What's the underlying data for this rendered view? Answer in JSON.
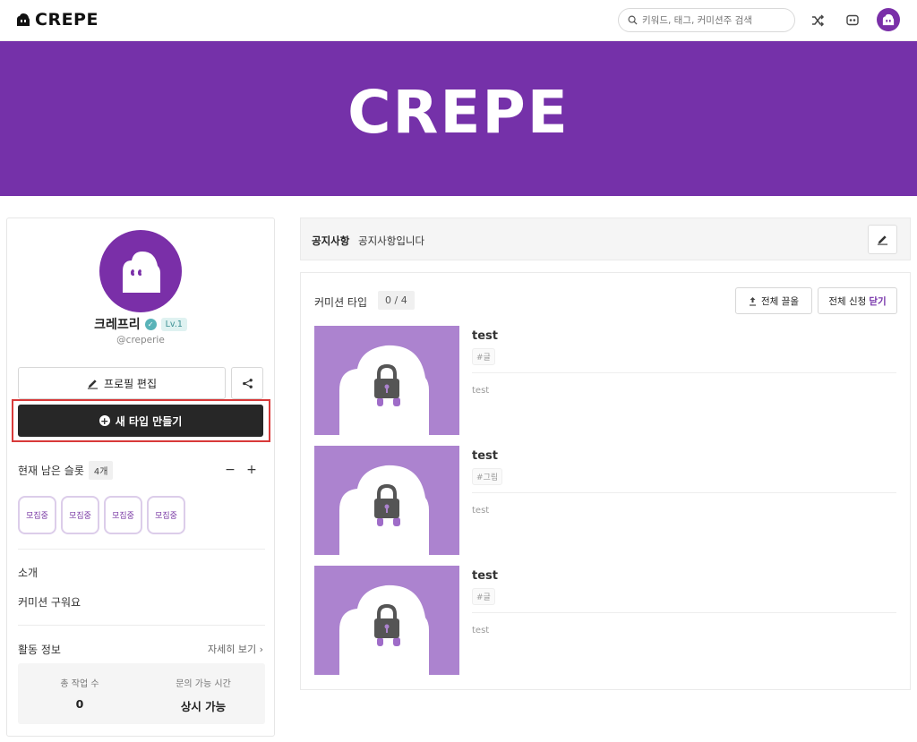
{
  "header": {
    "logo_text": "CREPE",
    "search_placeholder": "키워드, 태그, 커미션주 검색"
  },
  "banner": {
    "text": "CREPE"
  },
  "profile": {
    "name": "크레프리",
    "level": "Lv.1",
    "handle": "@creperie",
    "edit_label": "프로필 편집",
    "new_type_label": "새 타입 만들기"
  },
  "slots": {
    "label": "현재 남은 슬롯",
    "count": "4개",
    "minus": "−",
    "plus": "+",
    "chips": [
      "모집중",
      "모집중",
      "모집중",
      "모집중"
    ]
  },
  "intro": {
    "title": "소개",
    "text": "커미션 구워요"
  },
  "activity": {
    "title": "활동 정보",
    "more_label": "자세히 보기 ›",
    "stats": [
      {
        "label": "총 작업 수",
        "value": "0"
      },
      {
        "label": "문의 가능 시간",
        "value": "상시 가능"
      }
    ]
  },
  "notice": {
    "label": "공지사항",
    "text": "공지사항입니다"
  },
  "types": {
    "title": "커미션 타입",
    "count": "0 / 4",
    "pull_label": "전체 끌올",
    "apply_label": "전체 신청",
    "apply_accent": "닫기",
    "items": [
      {
        "title": "test",
        "tag": "#글",
        "desc": "test"
      },
      {
        "title": "test",
        "tag": "#그림",
        "desc": "test"
      },
      {
        "title": "test",
        "tag": "#글",
        "desc": "test"
      }
    ]
  },
  "colors": {
    "brand": "#7531a9",
    "thumb": "#ac83cf",
    "highlight": "#d83a3a"
  },
  "icons": [
    "search-icon",
    "shuffle-icon",
    "chat-icon",
    "avatar",
    "pencil-icon",
    "share-icon",
    "plus-circle-icon",
    "verified-icon",
    "pull-up-icon",
    "lock-icon"
  ]
}
